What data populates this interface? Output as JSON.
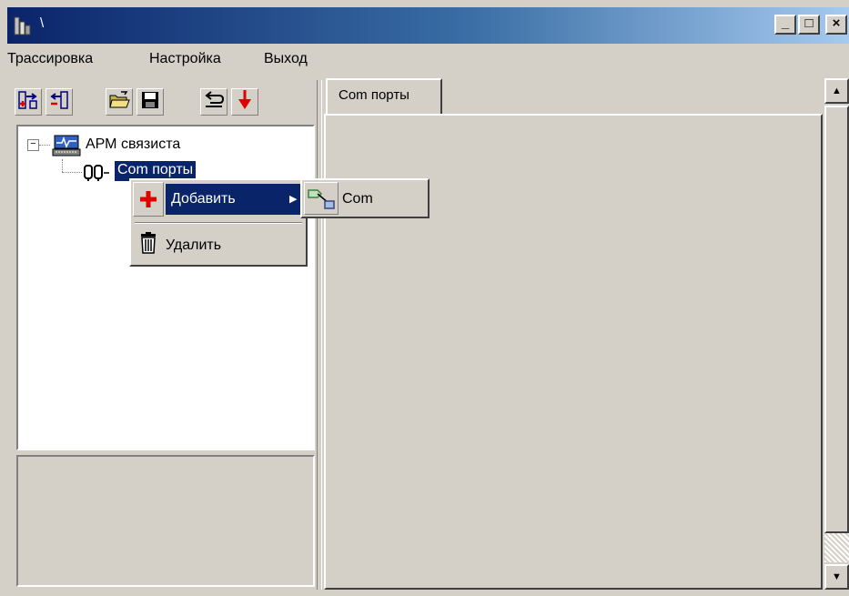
{
  "window": {
    "title": "\\",
    "minimize_label": "_",
    "maximize_label": "□",
    "close_label": "×"
  },
  "menu": {
    "items": [
      {
        "label": "Трассировка"
      },
      {
        "label": "Настройка"
      },
      {
        "label": "Выход"
      }
    ]
  },
  "toolbar": {
    "buttons": [
      {
        "icon": "add-connection-icon"
      },
      {
        "icon": "remove-connection-icon"
      },
      {
        "icon": "open-folder-icon"
      },
      {
        "icon": "save-icon"
      },
      {
        "icon": "undo-icon"
      },
      {
        "icon": "download-arrow-icon"
      }
    ]
  },
  "tree": {
    "expander": "−",
    "root": {
      "label": "АРМ связиста",
      "icon": "workstation-icon"
    },
    "child": {
      "label": "Com порты",
      "icon": "com-port-icon",
      "selected": true
    }
  },
  "tabs": [
    {
      "label": "Com порты",
      "active": true
    }
  ],
  "context_menu": {
    "items": [
      {
        "label": "Добавить",
        "icon": "add-icon",
        "highlighted": true,
        "has_submenu": true,
        "arrow": "▶"
      },
      {
        "label": "Удалить",
        "icon": "trash-icon"
      }
    ]
  },
  "submenu": {
    "items": [
      {
        "label": "Com",
        "icon": "com-connector-icon"
      }
    ]
  },
  "scrollbar": {
    "up_arrow": "▲",
    "down_arrow": "▼"
  },
  "colors": {
    "title_gradient_start": "#0a246a",
    "title_gradient_end": "#a6caf0",
    "highlight": "#0a246a",
    "face": "#d4d0c8"
  }
}
